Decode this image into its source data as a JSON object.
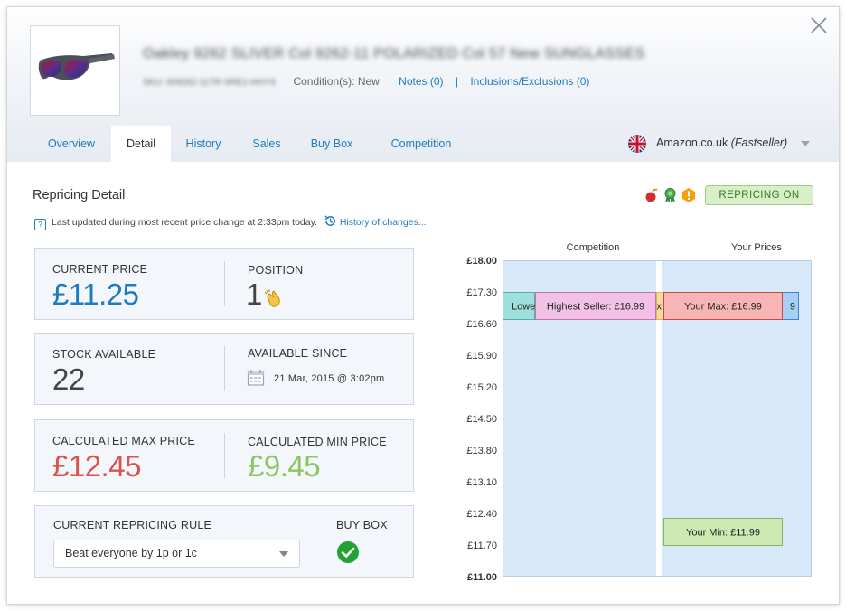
{
  "product": {
    "title": "Oakley 9262 SLIVER Col 9262-11 POLARIZED Col 57 New SUNGLASSES",
    "sku": "SKU: 009262-11TR-SRE1-HHYS",
    "condition": "Condition(s): New",
    "notes_link": "Notes (0)",
    "separator": "|",
    "inclusions_link": "Inclusions/Exclusions (0)"
  },
  "tabs": [
    "Overview",
    "Detail",
    "History",
    "Sales",
    "Buy Box",
    "Competition"
  ],
  "active_tab": "Detail",
  "marketplace": {
    "name": "Amazon.co.uk",
    "seller_type": "(Fastseller)"
  },
  "section": {
    "title": "Repricing Detail",
    "updated_text": "Last updated during most recent price change at 2:33pm today.",
    "history_link": "History of changes...",
    "help_glyph": "?",
    "repricing_badge": "REPRICING ON",
    "status_icons": [
      "bomb-icon",
      "award-ribbon-icon",
      "warning-hexagon-icon"
    ]
  },
  "cards": {
    "current_price": {
      "label": "CURRENT PRICE",
      "value": "£11.25"
    },
    "position": {
      "label": "POSITION",
      "value": "1",
      "icon": "clapping-hands-icon"
    },
    "stock": {
      "label": "STOCK AVAILABLE",
      "value": "22"
    },
    "available_since": {
      "label": "AVAILABLE SINCE",
      "value": "21 Mar, 2015 @ 3:02pm",
      "icon": "calendar-icon"
    },
    "max_price": {
      "label": "CALCULATED MAX PRICE",
      "value": "£12.45"
    },
    "min_price": {
      "label": "CALCULATED MIN PRICE",
      "value": "£9.45"
    },
    "rule": {
      "label": "CURRENT REPRICING RULE",
      "value": "Beat everyone by 1p or 1c"
    },
    "buy_box": {
      "label": "BUY BOX",
      "icon": "check-circle-icon",
      "won": true
    }
  },
  "chart_data": {
    "type": "range-chart",
    "columns": [
      "Competition",
      "Your Prices"
    ],
    "ylim": [
      11.0,
      18.0
    ],
    "yticks": [
      "£18.00",
      "£17.30",
      "£16.60",
      "£15.90",
      "£15.20",
      "£14.50",
      "£13.80",
      "£13.10",
      "£12.40",
      "£11.70",
      "£11.00"
    ],
    "ytick_values": [
      18.0,
      17.3,
      16.6,
      15.9,
      15.2,
      14.5,
      13.8,
      13.1,
      12.4,
      11.7,
      11.0
    ],
    "bold_ticks": [
      "£18.00",
      "£11.00"
    ],
    "markers": [
      {
        "column": "Competition",
        "label": "Lowe",
        "value": 16.99,
        "color": "#9fe0dc",
        "border": "#4bb3ad",
        "order": 0
      },
      {
        "column": "Competition",
        "label": "Highest Seller: £16.99",
        "value": 16.99,
        "color": "#f1c2e6",
        "border": "#c673b0",
        "order": 1
      },
      {
        "column": "Competition",
        "label": "x",
        "value": 16.99,
        "color": "#f7dca2",
        "border": "#d8b362",
        "order": 2
      },
      {
        "column": "Your Prices",
        "label": "9",
        "value": 16.99,
        "color": "#a8d0f4",
        "border": "#3c86d1",
        "order": 0
      },
      {
        "column": "Your Prices",
        "label": "Your Max: £16.99",
        "value": 16.99,
        "color": "#f7b5b5",
        "border": "#cf4545",
        "order": 1
      },
      {
        "column": "Your Prices",
        "label": "Your Min: £11.99",
        "value": 11.99,
        "color": "#cdeab5",
        "border": "#7fb85a",
        "order": 0
      }
    ],
    "colors": {
      "background": "#d7e8f8",
      "border": "#b8cde2"
    }
  }
}
